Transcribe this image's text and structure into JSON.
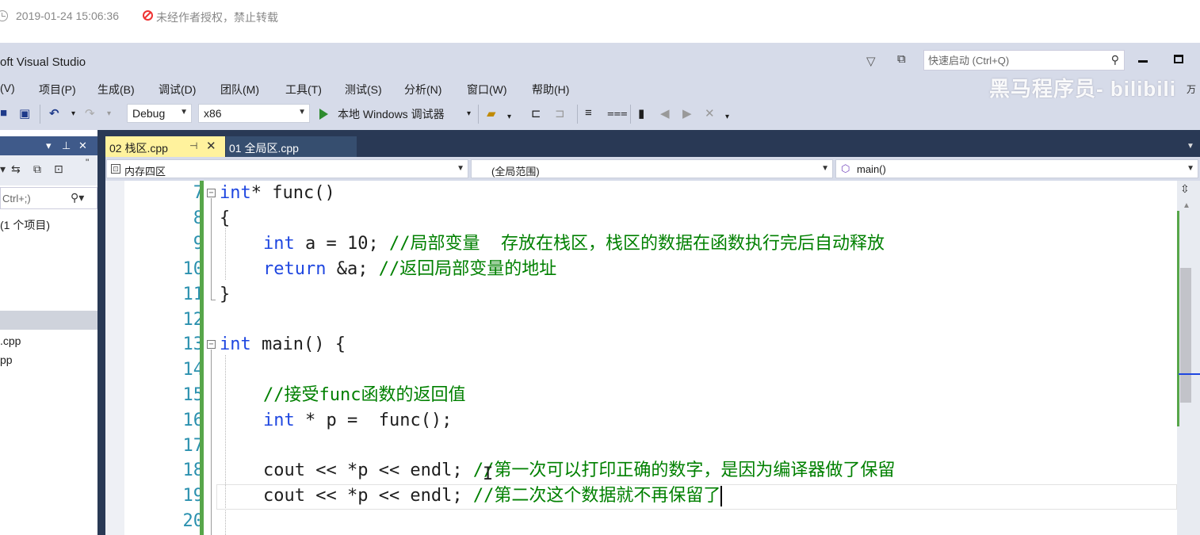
{
  "blog_meta": {
    "date": "2019-01-24 15:06:36",
    "copyright": "未经作者授权，禁止转载"
  },
  "window": {
    "title": "oft Visual Studio",
    "quick_launch_placeholder": "快速启动 (Ctrl+Q)"
  },
  "watermark": "黑马程序员- bilibili",
  "menu": [
    "(V)",
    "项目(P)",
    "生成(B)",
    "调试(D)",
    "团队(M)",
    "工具(T)",
    "测试(S)",
    "分析(N)",
    "窗口(W)",
    "帮助(H)"
  ],
  "menu_extra": "万",
  "toolbar": {
    "config": "Debug",
    "platform": "x86",
    "debugger": "本地 Windows 调试器"
  },
  "solution_explorer": {
    "search_hint": "Ctrl+;)",
    "solution_label": "(1 个项目)",
    "files": [
      ".cpp",
      "pp"
    ]
  },
  "tabs": [
    {
      "label": "02 栈区.cpp",
      "active": true
    },
    {
      "label": "01 全局区.cpp",
      "active": false
    }
  ],
  "nav": {
    "project": "内存四区",
    "scope": "(全局范围)",
    "member": "main()"
  },
  "editor": {
    "line_numbers": [
      "7",
      "8",
      "9",
      "10",
      "11",
      "12",
      "13",
      "14",
      "15",
      "16",
      "17",
      "18",
      "19",
      "20"
    ],
    "lines": {
      "l7": {
        "kw": "int",
        "rest": "* func()"
      },
      "l8": "{",
      "l9": {
        "kw": "int",
        "rest": " a = 10; ",
        "comment": "//局部变量  存放在栈区，栈区的数据在函数执行完后自动释放"
      },
      "l10": {
        "kw": "return",
        "rest": " &a; ",
        "comment": "//返回局部变量的地址"
      },
      "l11": "}",
      "l13": {
        "kw": "int",
        "rest": " main() {"
      },
      "l15": {
        "comment": "//接受func函数的返回值"
      },
      "l16": {
        "kw": "int",
        "rest": " * p =  func();"
      },
      "l18": {
        "code": "cout << *p << endl; ",
        "comment": "//第一次可以打印正确的数字，是因为编译器做了保留"
      },
      "l19": {
        "code": "cout << *p << endl; ",
        "comment": "//第二次这个数据就不再保留了"
      }
    }
  },
  "colors": {
    "keyword": "#1f47e0",
    "comment": "#008000",
    "line_number": "#2b91af",
    "active_tab": "#fff29d",
    "chrome": "#d6dbe9",
    "dark_chrome": "#293955"
  },
  "icons": [
    "clock-icon",
    "no-copy-icon",
    "filter-icon",
    "feedback-icon",
    "search-icon",
    "undo-icon",
    "redo-icon",
    "start-debug-icon",
    "bookmark-icon",
    "pin-icon",
    "close-icon"
  ]
}
